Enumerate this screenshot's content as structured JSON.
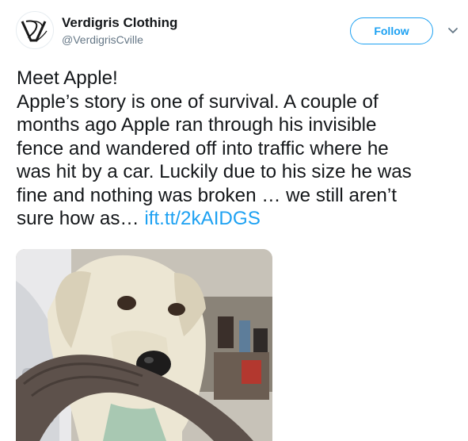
{
  "author": {
    "display_name": "Verdigris Clothing",
    "handle": "@VerdigrisCville",
    "avatar_icon": "verdigris-logo-avatar"
  },
  "follow_button": {
    "label": "Follow"
  },
  "menu": {
    "icon": "chevron-down-icon"
  },
  "tweet": {
    "lines": [
      "Meet Apple!",
      "Apple’s story is one of survival. A couple of",
      "months ago Apple ran through his invisible",
      "fence and wandered off into traffic where he",
      "was hit by a car. Luckily due to his size he was",
      "fine and nothing was broken … we still aren’t",
      "sure how as… "
    ],
    "link_text": "ift.tt/2kAIDGS"
  },
  "media": {
    "subject": "dog holding a ring toy in its mouth"
  },
  "colors": {
    "accent": "#1da1f2",
    "text": "#14171a",
    "secondary_text": "#657786"
  }
}
